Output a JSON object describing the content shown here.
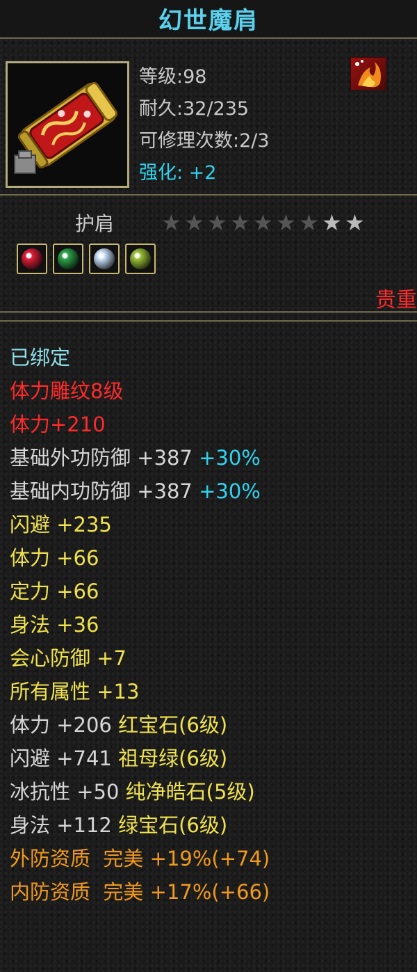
{
  "title": "幻世魔肩",
  "stats": {
    "level": "等级:98",
    "durability": "耐久:32/235",
    "repair": "可修理次数:2/3",
    "enhance": "强化: +2"
  },
  "icons": {
    "item": "shoulder-armor-icon",
    "badge": "flame-badge-icon",
    "star": "star-icon"
  },
  "type_label": "护肩",
  "stars": {
    "total": 9,
    "lit": 2
  },
  "gems": [
    {
      "name": "red-gem-icon",
      "color": "#e0203a"
    },
    {
      "name": "green-gem-icon",
      "color": "#2fa54a"
    },
    {
      "name": "white-gem-icon",
      "color": "#cfe6ff"
    },
    {
      "name": "yellow-green-gem-icon",
      "color": "#9dc43a"
    }
  ],
  "rarity": "贵重",
  "colors": {
    "title": "#5fd0ea",
    "cyan": "#2fd4f0",
    "red": "#ff2a2a",
    "white": "#d6d6d6",
    "yellow": "#f0e24e",
    "orange": "#f29a1d"
  },
  "props": [
    {
      "segs": [
        {
          "text": "已绑定",
          "color": "#8fe0ea"
        }
      ]
    },
    {
      "segs": [
        {
          "text": "体力雕纹8级",
          "color": "#ff2a2a"
        }
      ]
    },
    {
      "segs": [
        {
          "text": "体力+210",
          "color": "#ff2a2a"
        }
      ]
    },
    {
      "segs": [
        {
          "text": "基础外功防御 +387 ",
          "color": "#d6d6d6"
        },
        {
          "text": "+30%",
          "color": "#2fd4f0"
        }
      ]
    },
    {
      "segs": [
        {
          "text": "基础内功防御 +387 ",
          "color": "#d6d6d6"
        },
        {
          "text": "+30%",
          "color": "#2fd4f0"
        }
      ]
    },
    {
      "segs": [
        {
          "text": "闪避 +235",
          "color": "#f0e24e"
        }
      ]
    },
    {
      "segs": [
        {
          "text": "体力 +66",
          "color": "#f0e24e"
        }
      ]
    },
    {
      "segs": [
        {
          "text": "定力 +66",
          "color": "#f0e24e"
        }
      ]
    },
    {
      "segs": [
        {
          "text": "身法 +36",
          "color": "#f0e24e"
        }
      ]
    },
    {
      "segs": [
        {
          "text": "会心防御 +7",
          "color": "#f0e24e"
        }
      ]
    },
    {
      "segs": [
        {
          "text": "所有属性 +13",
          "color": "#f0e24e"
        }
      ]
    },
    {
      "segs": [
        {
          "text": "体力 +206 ",
          "color": "#d6d6d6"
        },
        {
          "text": "红宝石(6级)",
          "color": "#f0e24e"
        }
      ]
    },
    {
      "segs": [
        {
          "text": "闪避 +741 ",
          "color": "#d6d6d6"
        },
        {
          "text": "祖母绿(6级)",
          "color": "#f0e24e"
        }
      ]
    },
    {
      "segs": [
        {
          "text": "冰抗性 +50 ",
          "color": "#d6d6d6"
        },
        {
          "text": "纯净皓石(5级)",
          "color": "#f0e24e"
        }
      ]
    },
    {
      "segs": [
        {
          "text": "身法 +112 ",
          "color": "#d6d6d6"
        },
        {
          "text": "绿宝石(6级)",
          "color": "#f0e24e"
        }
      ]
    },
    {
      "segs": [
        {
          "text": "外防资质  完美 +19%(+74)",
          "color": "#f29a1d"
        }
      ]
    },
    {
      "segs": [
        {
          "text": "内防资质  完美 +17%(+66)",
          "color": "#f29a1d"
        }
      ]
    }
  ]
}
